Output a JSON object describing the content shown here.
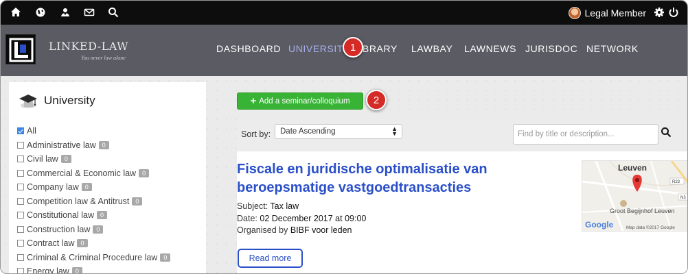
{
  "topbar": {
    "icons": [
      "home-icon",
      "globe-icon",
      "people-icon",
      "envelope-icon",
      "search-icon"
    ],
    "user_name": "Legal Member",
    "settings_icon": "gear-icon",
    "power_icon": "power-icon"
  },
  "brand": {
    "name": "LINKED-LAW",
    "tagline": "You never law alone"
  },
  "nav": {
    "items": [
      "DASHBOARD",
      "UNIVERSITY",
      "LIBRARY",
      "LAWBAY",
      "LAWNEWS",
      "JURISDOC",
      "NETWORK"
    ],
    "active": "UNIVERSITY"
  },
  "callouts": [
    "1",
    "2"
  ],
  "sidebar": {
    "title": "University",
    "categories": [
      {
        "label": "All",
        "checked": true,
        "count": ""
      },
      {
        "label": "Administrative law",
        "checked": false,
        "count": "0"
      },
      {
        "label": "Civil law",
        "checked": false,
        "count": "0"
      },
      {
        "label": "Commercial & Economic law",
        "checked": false,
        "count": "0"
      },
      {
        "label": "Company law",
        "checked": false,
        "count": "0"
      },
      {
        "label": "Competition law & Antitrust",
        "checked": false,
        "count": "0"
      },
      {
        "label": "Constitutional law",
        "checked": false,
        "count": "0"
      },
      {
        "label": "Construction law",
        "checked": false,
        "count": "0"
      },
      {
        "label": "Contract law",
        "checked": false,
        "count": "0"
      },
      {
        "label": "Criminal & Criminal Procedure law",
        "checked": false,
        "count": "0"
      },
      {
        "label": "Energy law",
        "checked": false,
        "count": "0"
      }
    ]
  },
  "main": {
    "add_button": "Add a seminar/colloquium",
    "sort_label": "Sort by:",
    "sort_value": "Date Ascending",
    "search_placeholder": "Find by title or description...",
    "event": {
      "title": "Fiscale en juridische optimalisatie van beroepsmatige vastgoedtransacties",
      "subject_label": "Subject:",
      "subject": "Tax law",
      "date_label": "Date:",
      "date": "02 December 2017 at 09:00",
      "organiser_label": "Organised by",
      "organiser": "BIBF voor leden",
      "read_more": "Read more",
      "map": {
        "city": "Leuven",
        "place": "Groot Begijnhof Leuven",
        "road_a": "R23",
        "road_b": "N3",
        "credit": "Map data ©2017 Google",
        "logo": "Google"
      }
    }
  },
  "colors": {
    "topbar": "#0d0d0d",
    "navbar": "#5b5b64",
    "accent_blue": "#2a4fc9",
    "add_green": "#38b336",
    "callout_red": "#d52b27"
  }
}
